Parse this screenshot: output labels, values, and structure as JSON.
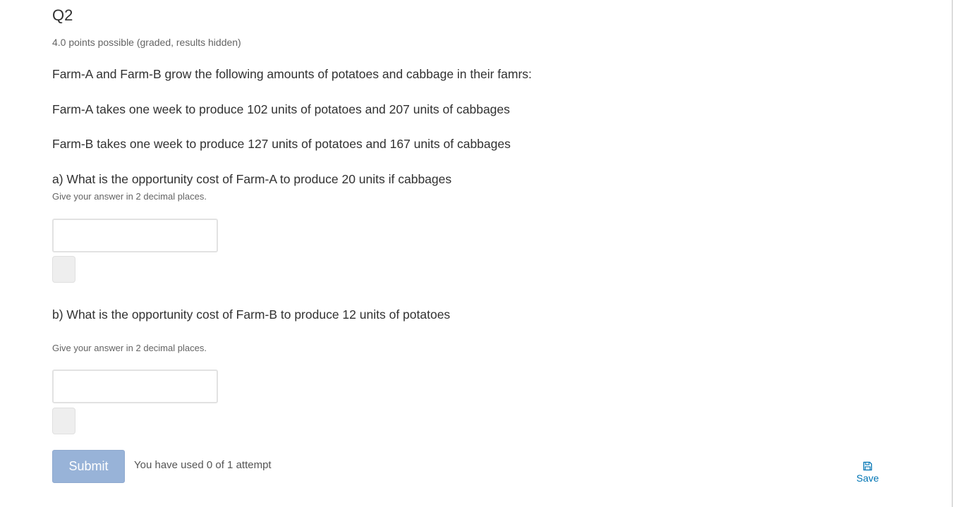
{
  "problem": {
    "title": "Q2",
    "points": "4.0 points possible (graded, results hidden)",
    "intro": "Farm-A and Farm-B grow the following amounts of potatoes and cabbage in their famrs:",
    "farm_a": "Farm-A takes one week to produce 102 units of potatoes and 207 units of cabbages",
    "farm_b": "Farm-B takes one week to produce 127 units of potatoes and 167 units of cabbages",
    "question_a": {
      "label": "a) What is the opportunity cost of Farm-A to produce 20 units if cabbages",
      "hint": "Give your answer in 2 decimal places.",
      "value": ""
    },
    "question_b": {
      "label": "b) What is the opportunity cost of Farm-B to produce 12 units of potatoes",
      "hint": "Give your answer in 2 decimal places.",
      "value": ""
    }
  },
  "actions": {
    "submit_label": "Submit",
    "attempts_text": "You have used 0 of 1 attempt",
    "save_label": "Save",
    "save_icon": "floppy-disk-icon"
  },
  "colors": {
    "submit_bg": "#98b3d8",
    "link": "#0075b4",
    "text": "#313131",
    "muted": "#646464"
  }
}
